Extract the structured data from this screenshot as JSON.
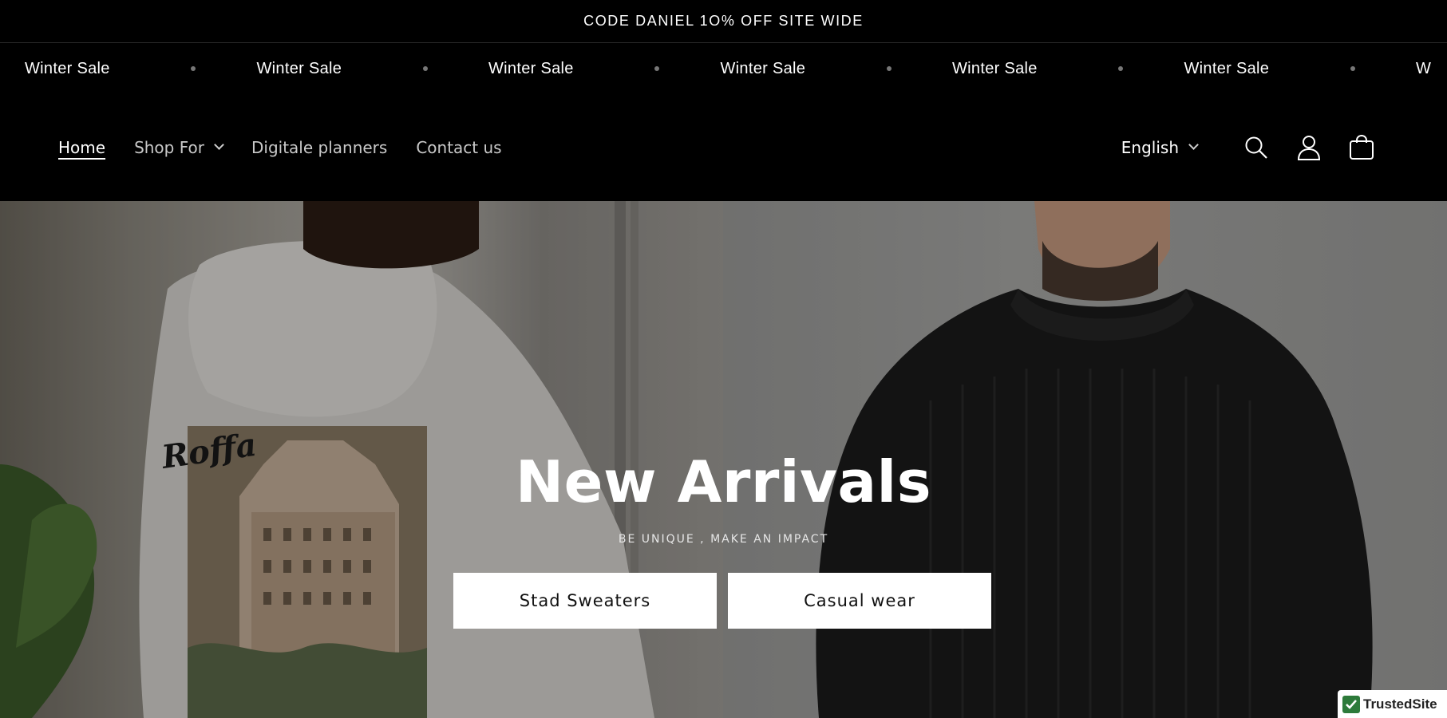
{
  "announcement": {
    "text": "CODE DANIEL 1O% OFF SITE WIDE"
  },
  "marquee": {
    "items": [
      "Winter Sale",
      "Winter Sale",
      "Winter Sale",
      "Winter Sale",
      "Winter Sale",
      "Winter Sale",
      "W"
    ]
  },
  "nav": {
    "home": "Home",
    "shop_for": "Shop For",
    "planners": "Digitale planners",
    "contact": "Contact us"
  },
  "header": {
    "language": "English",
    "icons": [
      "search-icon",
      "account-icon",
      "cart-icon"
    ]
  },
  "hero": {
    "title": "New Arrivals",
    "subtitle": "BE UNIQUE , MAKE AN IMPACT",
    "buttons": [
      "Stad Sweaters",
      "Casual wear"
    ]
  },
  "badge": {
    "label": "TrustedSite"
  }
}
